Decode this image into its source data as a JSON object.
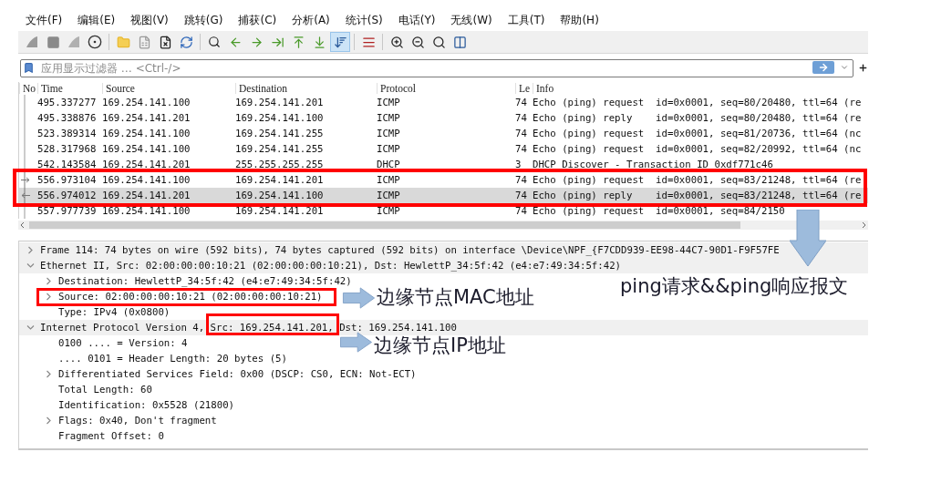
{
  "menu": [
    "文件(F)",
    "编辑(E)",
    "视图(V)",
    "跳转(G)",
    "捕获(C)",
    "分析(A)",
    "统计(S)",
    "电话(Y)",
    "无线(W)",
    "工具(T)",
    "帮助(H)"
  ],
  "toolbar": [
    {
      "selected": false
    },
    {
      "selected": false
    },
    {
      "selected": false
    },
    {
      "selected": false
    },
    {
      "selected": false
    },
    {
      "selected": false
    },
    {
      "selected": false
    },
    {
      "selected": false
    },
    {
      "selected": false
    },
    {
      "selected": false
    },
    {
      "selected": false
    },
    {
      "selected": false
    },
    {
      "selected": false
    },
    {
      "selected": false
    },
    {
      "selected": true
    },
    {
      "selected": false
    },
    {
      "selected": false
    },
    {
      "selected": false
    },
    {
      "selected": false
    },
    {
      "selected": false
    }
  ],
  "filter": {
    "placeholder": "应用显示过滤器 … <Ctrl-/>"
  },
  "packet_list": {
    "columns": [
      "No",
      "Time",
      "Source",
      "Destination",
      "Protocol",
      "Le",
      "Info"
    ],
    "rows": [
      {
        "time": "495.337277",
        "source": "169.254.141.100",
        "destination": "169.254.141.201",
        "protocol": "ICMP",
        "length": "74",
        "info": "Echo (ping) request  id=0x0001, seq=80/20480, ttl=64 (re",
        "kind": "plain",
        "selected": false
      },
      {
        "time": "495.338876",
        "source": "169.254.141.201",
        "destination": "169.254.141.100",
        "protocol": "ICMP",
        "length": "74",
        "info": "Echo (ping) reply    id=0x0001, seq=80/20480, ttl=64 (re",
        "kind": "plain",
        "selected": false
      },
      {
        "time": "523.389314",
        "source": "169.254.141.100",
        "destination": "169.254.141.255",
        "protocol": "ICMP",
        "length": "74",
        "info": "Echo (ping) request  id=0x0001, seq=81/20736, ttl=64 (nc",
        "kind": "plain",
        "selected": false
      },
      {
        "time": "528.317968",
        "source": "169.254.141.100",
        "destination": "169.254.141.255",
        "protocol": "ICMP",
        "length": "74",
        "info": "Echo (ping) request  id=0x0001, seq=82/20992, ttl=64 (nc",
        "kind": "plain",
        "selected": false
      },
      {
        "time": "542.143584",
        "source": "169.254.141.201",
        "destination": "255.255.255.255",
        "protocol": "DHCP",
        "length": "3",
        "info": "DHCP Discover - Transaction ID 0xdf771c46",
        "kind": "plain",
        "selected": false
      },
      {
        "time": "556.973104",
        "source": "169.254.141.100",
        "destination": "169.254.141.201",
        "protocol": "ICMP",
        "length": "74",
        "info": "Echo (ping) request  id=0x0001, seq=83/21248, ttl=64 (re",
        "kind": "request",
        "selected": false
      },
      {
        "time": "556.974012",
        "source": "169.254.141.201",
        "destination": "169.254.141.100",
        "protocol": "ICMP",
        "length": "74",
        "info": "Echo (ping) reply    id=0x0001, seq=83/21248, ttl=64 (re",
        "kind": "reply",
        "selected": true
      },
      {
        "time": "557.977739",
        "source": "169.254.141.100",
        "destination": "169.254.141.201",
        "protocol": "ICMP",
        "length": "74",
        "info": "Echo (ping) request  id=0x0001, seq=84/2150",
        "kind": "plain",
        "selected": false
      }
    ]
  },
  "details": [
    {
      "text": "Frame 114: 74 bytes on wire (592 bits), 74 bytes captured (592 bits) on interface \\Device\\NPF_{F7CDD939-EE98-44C7-90D1-F9F57FE",
      "expanded": false
    },
    {
      "text": "Ethernet II, Src: 02:00:00:00:10:21 (02:00:00:00:10:21), Dst: HewlettP_34:5f:42 (e4:e7:49:34:5f:42)",
      "expanded": true,
      "children": [
        {
          "text": "Destination: HewlettP_34:5f:42 (e4:e7:49:34:5f:42)",
          "expanded": false
        },
        {
          "text": "Source: 02:00:00:00:10:21 (02:00:00:00:10:21)",
          "expanded": false
        },
        {
          "text": "Type: IPv4 (0x0800)"
        }
      ]
    },
    {
      "text": "Internet Protocol Version 4, Src: 169.254.141.201, Dst: 169.254.141.100",
      "expanded": true,
      "children": [
        {
          "text": "0100 .... = Version: 4"
        },
        {
          "text": ".... 0101 = Header Length: 20 bytes (5)"
        },
        {
          "text": "Differentiated Services Field: 0x00 (DSCP: CS0, ECN: Not-ECT)",
          "expanded": false
        },
        {
          "text": "Total Length: 60"
        },
        {
          "text": "Identification: 0x5528 (21800)"
        },
        {
          "text": "Flags: 0x40, Don't fragment",
          "expanded": false
        },
        {
          "text": "Fragment Offset: 0"
        }
      ]
    }
  ],
  "annotations": [
    {
      "text": "ping请求&&ping响应报文"
    },
    {
      "text": "边缘节点MAC地址"
    },
    {
      "text": "边缘节点IP地址"
    }
  ]
}
